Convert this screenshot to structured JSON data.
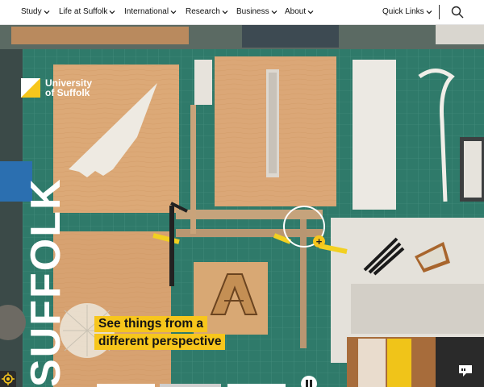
{
  "nav": {
    "items": [
      {
        "label": "Study"
      },
      {
        "label": "Life at Suffolk"
      },
      {
        "label": "International"
      },
      {
        "label": "Research"
      },
      {
        "label": "Business"
      },
      {
        "label": "About"
      }
    ],
    "quick_links": "Quick Links",
    "search_icon": "search-icon"
  },
  "logo": {
    "line1": "University",
    "line2": "of Suffolk"
  },
  "hero": {
    "vertical_brand": "SUFFOLK",
    "headline_line1": "See things from a",
    "headline_line2": "different perspective",
    "hotspot_symbol": "+"
  },
  "colors": {
    "accent": "#f7c61c",
    "cutting_mat": "#2f7a6a",
    "nav_bg": "#ffffff"
  },
  "icons": [
    "chevron-down-icon",
    "search-icon",
    "pause-icon",
    "accessibility-icon",
    "chat-icon"
  ]
}
